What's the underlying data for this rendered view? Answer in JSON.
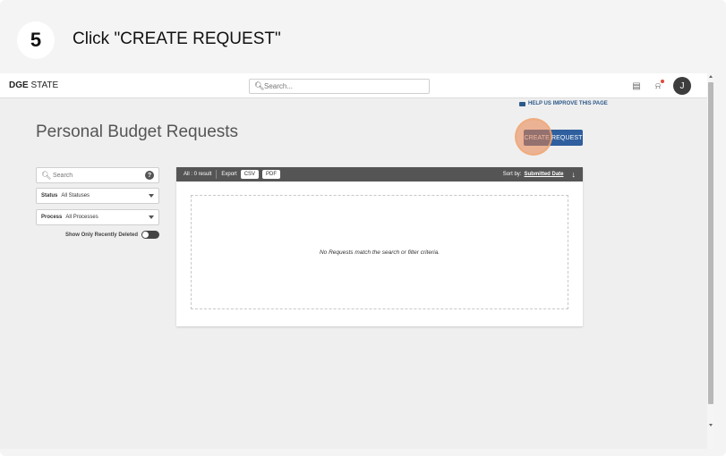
{
  "step": {
    "number": "5",
    "instruction": "Click \"CREATE REQUEST\""
  },
  "app": {
    "brand_bold": "DGE",
    "brand_rest": " STATE",
    "top_search": {
      "placeholder": "Search..."
    },
    "avatar_initial": "J",
    "help_link": "HELP US IMPROVE THIS PAGE",
    "page_title": "Personal Budget Requests",
    "create_button": "CREATE REQUEST",
    "filters": {
      "search_placeholder": "Search",
      "status_label": "Status",
      "status_value": "All Statuses",
      "process_label": "Process",
      "process_value": "All Processes",
      "toggle_label": "Show Only Recently Deleted"
    },
    "results": {
      "count_text": "All : 0 result",
      "export_label": "Export",
      "csv_label": "CSV",
      "pdf_label": "PDF",
      "sort_label": "Sort by:",
      "sort_value": "Submitted Date",
      "empty_message": "No Requests match the search or filter criteria."
    }
  },
  "colors": {
    "primary_button": "#2f5f9e",
    "highlight": "#e88048",
    "results_header": "#555555"
  },
  "icons": [
    "search-icon",
    "archive-icon",
    "bell-icon",
    "help-icon",
    "chevron-down-icon",
    "sort-arrow-icon"
  ]
}
